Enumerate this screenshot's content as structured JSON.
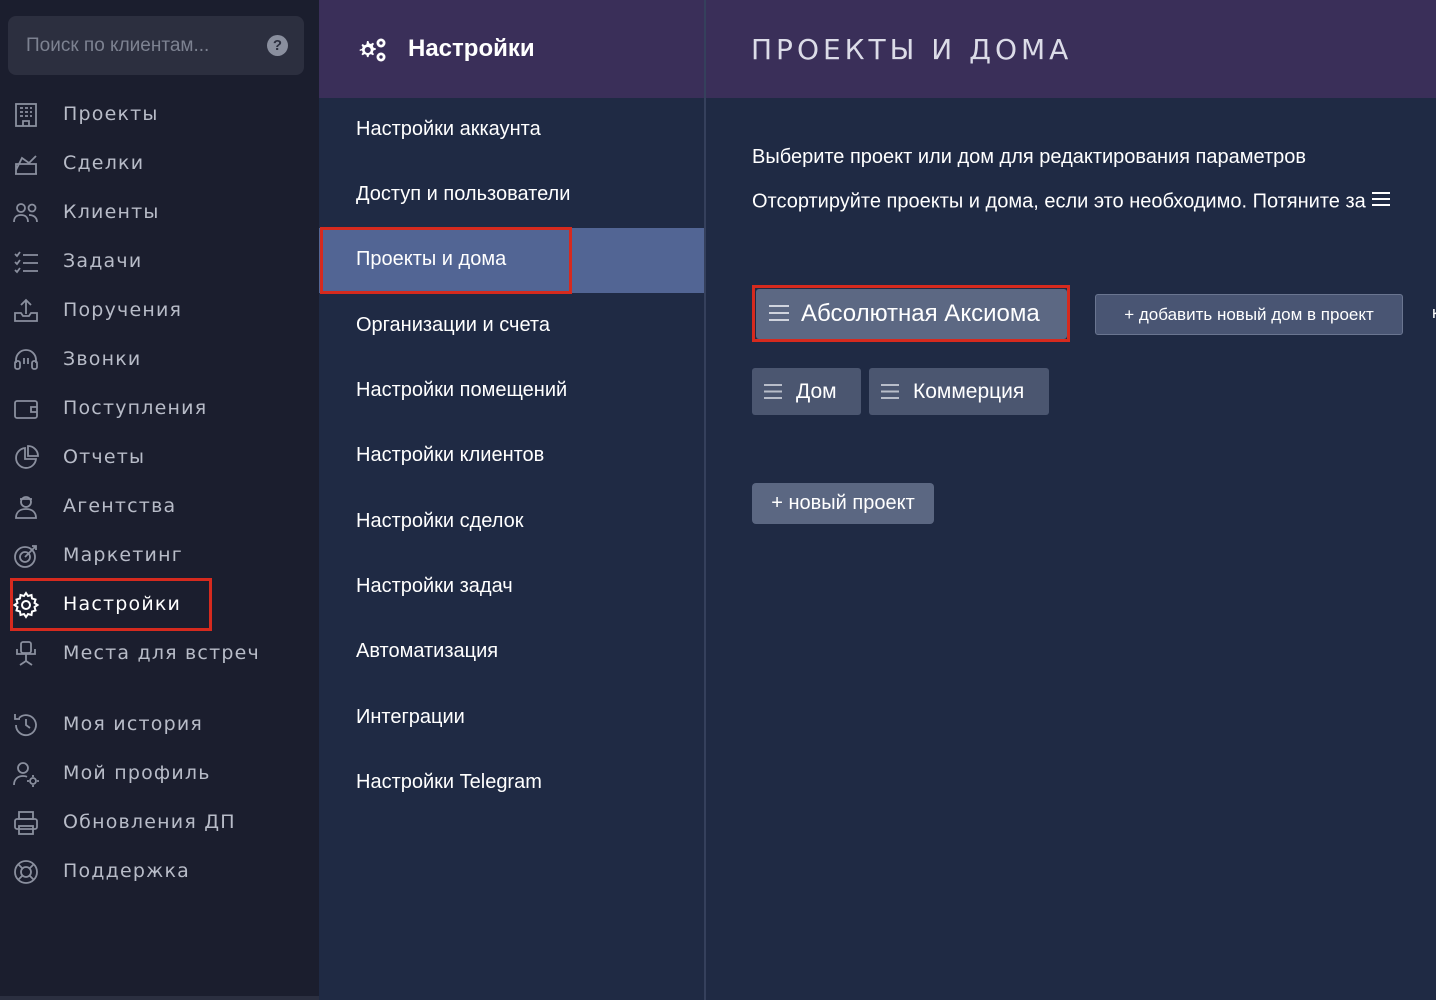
{
  "search": {
    "placeholder": "Поиск по клиентам...",
    "help": "?"
  },
  "sidebar": {
    "items": [
      {
        "label": "Проекты",
        "icon": "building-icon"
      },
      {
        "label": "Сделки",
        "icon": "deal-icon"
      },
      {
        "label": "Клиенты",
        "icon": "users-icon"
      },
      {
        "label": "Задачи",
        "icon": "tasks-icon"
      },
      {
        "label": "Поручения",
        "icon": "upload-tray-icon"
      },
      {
        "label": "Звонки",
        "icon": "headset-icon"
      },
      {
        "label": "Поступления",
        "icon": "wallet-icon"
      },
      {
        "label": "Отчеты",
        "icon": "pie-chart-icon"
      },
      {
        "label": "Агентства",
        "icon": "agent-icon"
      },
      {
        "label": "Маркетинг",
        "icon": "target-icon"
      },
      {
        "label": "Настройки",
        "icon": "gear-icon"
      },
      {
        "label": "Места для встреч",
        "icon": "meeting-place-icon"
      }
    ],
    "bottom_items": [
      {
        "label": "Моя история",
        "icon": "history-icon"
      },
      {
        "label": "Мой профиль",
        "icon": "profile-settings-icon"
      },
      {
        "label": "Обновления ДП",
        "icon": "printer-icon"
      },
      {
        "label": "Поддержка",
        "icon": "lifebuoy-icon"
      }
    ]
  },
  "settings": {
    "title": "Настройки",
    "menu": [
      "Настройки аккаунта",
      "Доступ и пользователи",
      "Проекты и дома",
      "Организации и счета",
      "Настройки помещений",
      "Настройки клиентов",
      "Настройки сделок",
      "Настройки задач",
      "Автоматизация",
      "Интеграции",
      "Настройки Telegram"
    ]
  },
  "content": {
    "title": "ПРОЕКТЫ И ДОМА",
    "line1": "Выберите проект или дом для редактирования параметров",
    "line2": "Отсортируйте проекты и дома, если это необходимо. Потяните за",
    "project": "Абсолютная Аксиома",
    "add_house": "+ добавить новый дом в проект",
    "edge_char": "к",
    "houses": [
      "Дом",
      "Коммерция"
    ],
    "new_project": "+ новый проект"
  },
  "colors": {
    "sidebar_bg": "#1b1e2e",
    "header_purple": "#3a2f59",
    "panel_bg": "#1f2a44",
    "selected_menu": "#526594",
    "highlight_red": "#d62a1e"
  }
}
